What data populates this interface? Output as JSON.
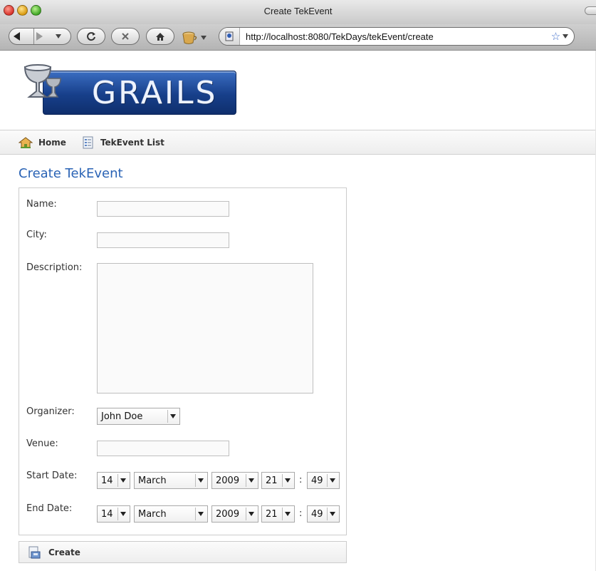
{
  "window": {
    "title": "Create TekEvent"
  },
  "browser": {
    "url": "http://localhost:8080/TekDays/tekEvent/create"
  },
  "logo": {
    "text": "GRAILS"
  },
  "nav": {
    "items": [
      {
        "label": "Home",
        "icon": "house-icon"
      },
      {
        "label": "TekEvent List",
        "icon": "list-document-icon"
      }
    ]
  },
  "page": {
    "title": "Create TekEvent"
  },
  "form": {
    "name": {
      "label": "Name:",
      "value": ""
    },
    "city": {
      "label": "City:",
      "value": ""
    },
    "description": {
      "label": "Description:",
      "value": ""
    },
    "organizer": {
      "label": "Organizer:",
      "value": "John Doe"
    },
    "venue": {
      "label": "Venue:",
      "value": ""
    },
    "start_date": {
      "label": "Start Date:",
      "day": "14",
      "month": "March",
      "year": "2009",
      "hour": "21",
      "minute": "49",
      "separator": ":"
    },
    "end_date": {
      "label": "End Date:",
      "day": "14",
      "month": "March",
      "year": "2009",
      "hour": "21",
      "minute": "49",
      "separator": ":"
    }
  },
  "actions": {
    "create_label": "Create"
  },
  "colors": {
    "title_blue": "#2a63b5",
    "logo_blue": "#173f8a"
  }
}
